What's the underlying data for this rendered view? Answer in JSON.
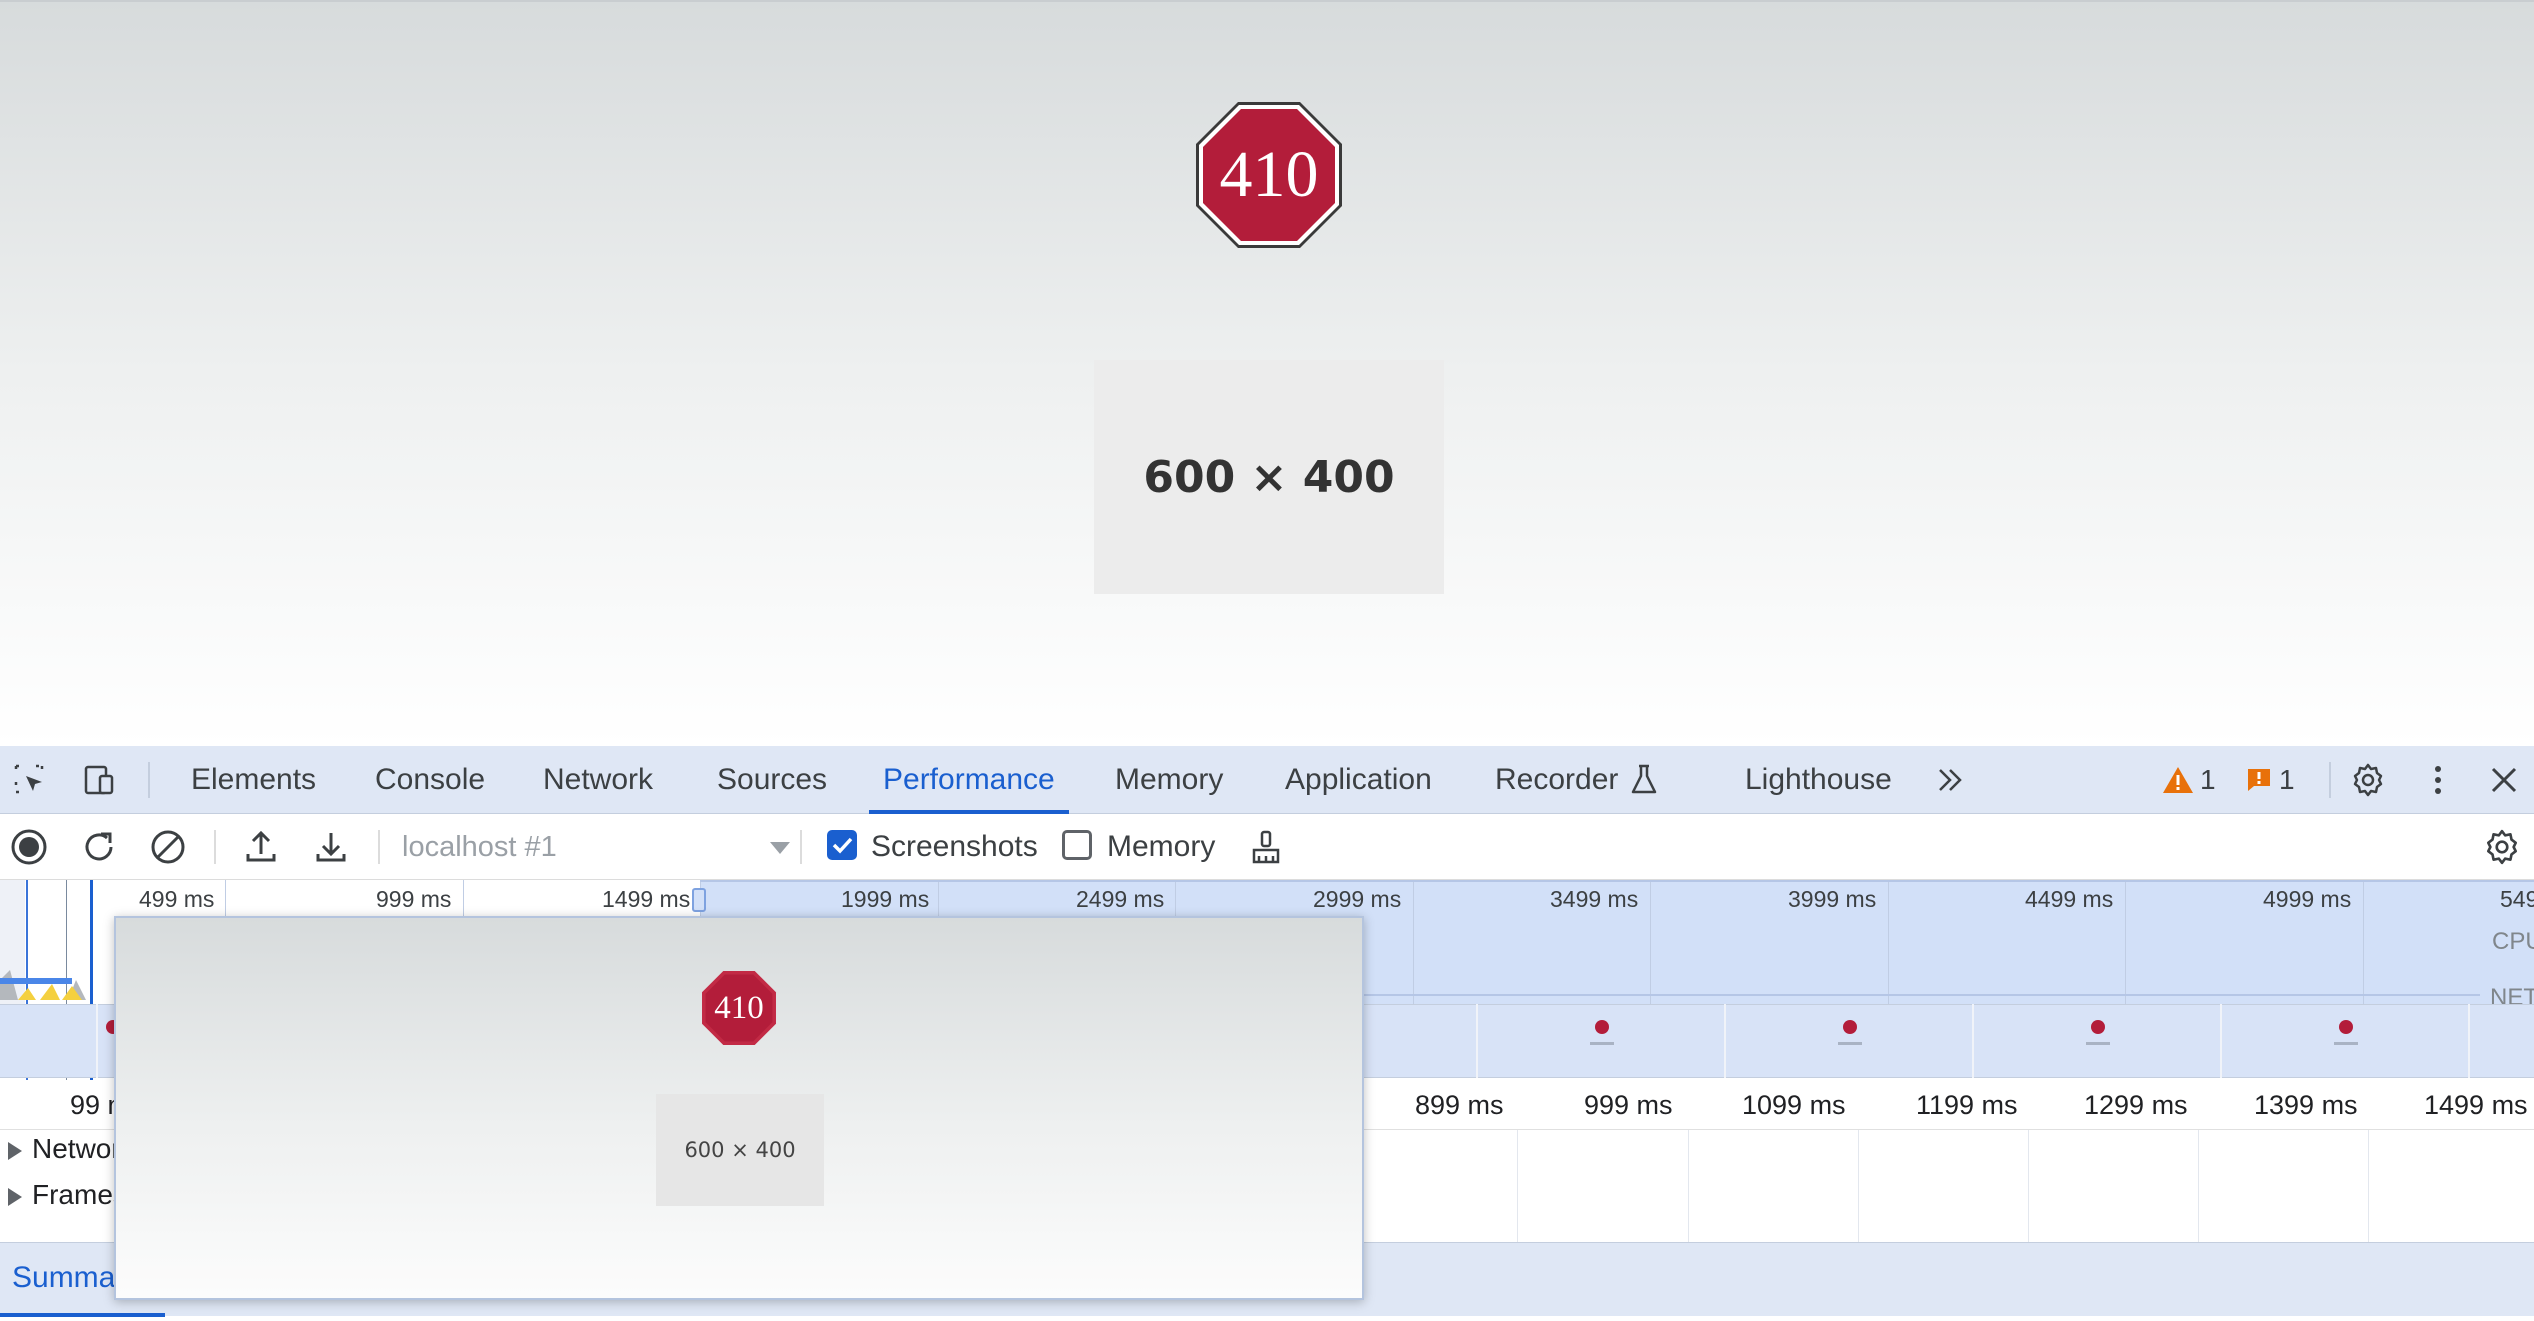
{
  "page": {
    "stop_sign_text": "410",
    "placeholder_text": "600 × 400",
    "colors": {
      "stop_red": "#b31d3a",
      "accent": "#1a5fcf"
    }
  },
  "devtools": {
    "tabs": [
      "Elements",
      "Console",
      "Network",
      "Sources",
      "Performance",
      "Memory",
      "Application",
      "Recorder",
      "Lighthouse"
    ],
    "active_tab": "Performance",
    "more_tabs_icon": "chevron-double-right-icon",
    "warning_count": "1",
    "issue_count": "1",
    "toolbar": {
      "target": "localhost #1",
      "screenshots_label": "Screenshots",
      "screenshots_checked": true,
      "memory_label": "Memory",
      "memory_checked": false
    },
    "overview": {
      "time_labels": [
        "499 ms",
        "999 ms",
        "1499 ms",
        "1999 ms",
        "2499 ms",
        "2999 ms",
        "3499 ms",
        "3999 ms",
        "4499 ms",
        "4999 ms",
        "549"
      ],
      "lanes": [
        "CPU",
        "NET"
      ]
    },
    "ruler": {
      "labels": [
        "99 ms",
        "899 ms",
        "999 ms",
        "1099 ms",
        "1199 ms",
        "1299 ms",
        "1399 ms",
        "1499 ms"
      ]
    },
    "tracks": [
      "Network",
      "Frames"
    ],
    "bottom_tab": "Summary",
    "screenshot_popover": {
      "stop_sign_text": "410",
      "placeholder_text": "600 × 400"
    }
  }
}
